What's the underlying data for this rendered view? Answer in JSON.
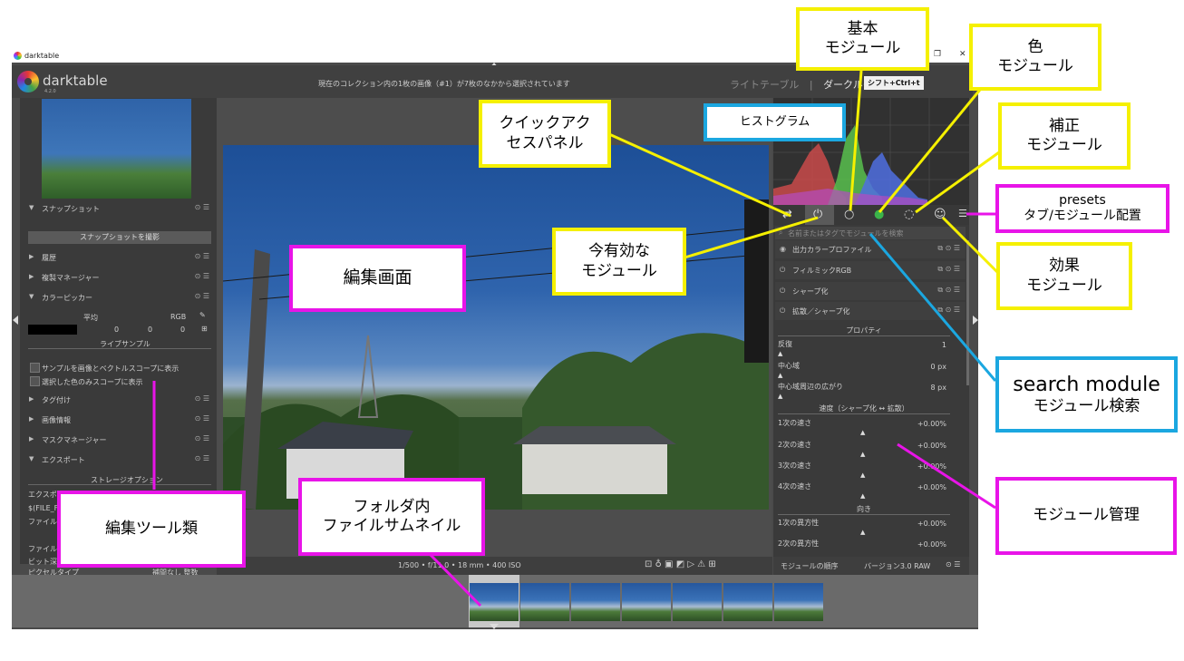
{
  "window": {
    "title": "darktable"
  },
  "header": {
    "brand": "darktable",
    "version": "4.2.0",
    "collection_info": "現在のコレクション内の1枚の画像（#1）が7枚のなかから選択されています",
    "view_lighttable": "ライトテーブル",
    "view_sep": "|",
    "view_darkroom": "ダークルー",
    "shortcut_hint": "シフト+Ctrl+t"
  },
  "left_panel": {
    "snapshots": "スナップショット",
    "take_snapshot": "スナップショットを撮影",
    "history": "履歴",
    "duplicate_manager": "複製マネージャー",
    "color_picker": "カラーピッカー",
    "mean": "平均",
    "rgb": "RGB",
    "val0": "0",
    "val1": "0",
    "val2": "0",
    "live_samples": "ライブサンプル",
    "show_sample": "サンプルを画像とベクトルスコープに表示",
    "show_selected": "選択した色のみスコープに表示",
    "tagging": "タグ付け",
    "image_info": "画像情報",
    "mask_manager": "マスクマネージャー",
    "export": "エクスポート",
    "storage_options": "ストレージオプション",
    "export_partial": "エクスポー",
    "file_field": "$(FILE_FO",
    "file_name_partial": "ファイル名",
    "file_format_partial": "ファイルフ",
    "bit_depth_partial": "ビット深度",
    "pixel_type_partial": "ピクセルタイプ",
    "pixel_value_partial": "補間なし 整数"
  },
  "bottom_bar": {
    "exif": "1/500 • f/11.0 • 18 mm • 400 ISO"
  },
  "right_panel": {
    "search_placeholder": "名前またはタグでモジュールを検索",
    "modules": [
      {
        "label": "出力カラープロファイル"
      },
      {
        "label": "フィルミックRGB"
      },
      {
        "label": "シャープ化"
      },
      {
        "label": "拡散／シャープ化"
      }
    ],
    "properties": "プロパティ",
    "iterations": "反復",
    "iterations_val": "1",
    "central_radius": "中心域",
    "central_radius_val": "0 px",
    "radius_span": "中心域周辺の広がり",
    "radius_span_val": "8 px",
    "speed_section": "速度（シャープ化 ↔ 拡散）",
    "speed1": "1次の速さ",
    "speed2": "2次の速さ",
    "speed3": "3次の速さ",
    "speed4": "4次の速さ",
    "speed_val": "+0.00%",
    "direction": "向き",
    "aniso1": "1次の異方性",
    "aniso2": "2次の異方性",
    "module_order": "モジュールの順序",
    "version": "バージョン3.0 RAW"
  },
  "annotations": {
    "basic": [
      "基本",
      "モジュール"
    ],
    "color": [
      "色",
      "モジュール"
    ],
    "correct": [
      "補正",
      "モジュール"
    ],
    "quick_access": [
      "クイックアク",
      "セスパネル"
    ],
    "histogram": "ヒストグラム",
    "presets": [
      "presets",
      "タブ/モジュール配置"
    ],
    "active": [
      "今有効な",
      "モジュール"
    ],
    "effects": [
      "効果",
      "モジュール"
    ],
    "edit_screen": "編集画面",
    "search_module": [
      "search module",
      "モジュール検索"
    ],
    "module_manage": "モジュール管理",
    "edit_tools": "編集ツール類",
    "folder_thumbs": [
      "フォルダ内",
      "ファイルサムネイル"
    ]
  },
  "colors": {
    "yellow": "#f5f000",
    "magenta": "#e814e8",
    "cyan": "#1ba7e0"
  }
}
